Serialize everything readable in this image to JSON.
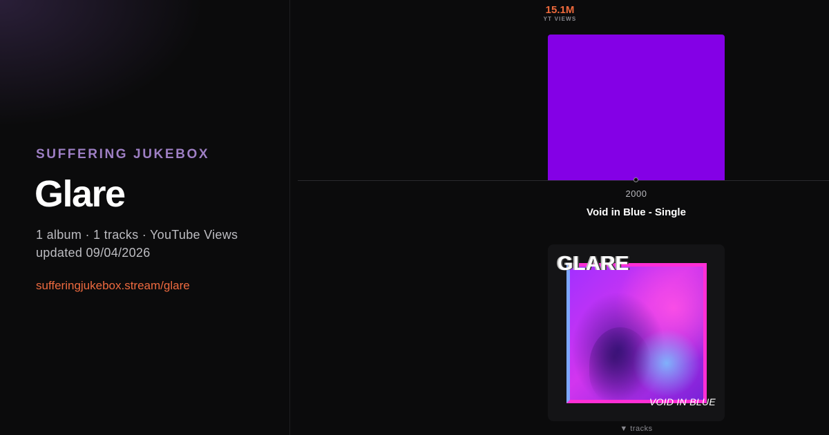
{
  "sidebar": {
    "site_name": "SUFFERING JUKEBOX",
    "artist_name": "Glare",
    "summary_line": "1 album · 1 tracks · YouTube Views",
    "updated_line": "updated 09/04/2026",
    "link_text": "sufferingjukebox.stream/glare"
  },
  "chart": {
    "metric_value": "15.1M",
    "metric_label": "YT VIEWS",
    "bar_color": "#8400e6",
    "year": "2000",
    "album_title": "Void in Blue - Single",
    "tracks_label": "▼ tracks"
  },
  "cover": {
    "artist_text": "GLARE",
    "subtitle_text": "VOID IN BLUE"
  },
  "chart_data": {
    "type": "bar",
    "categories": [
      "2000"
    ],
    "series": [
      {
        "name": "YT VIEWS",
        "values": [
          15100000
        ]
      }
    ]
  }
}
